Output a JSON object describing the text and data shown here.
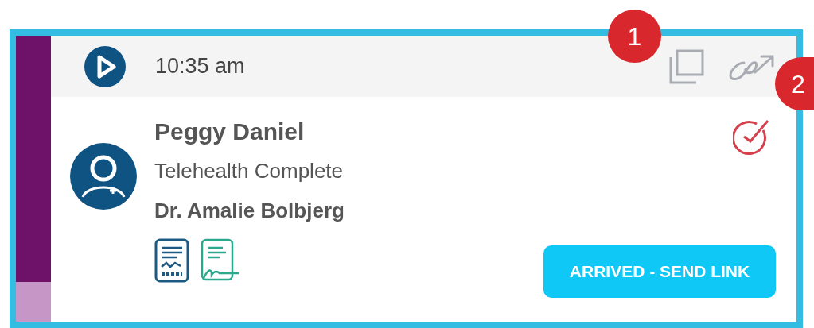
{
  "appointment": {
    "time": "10:35 am",
    "patient": "Peggy Daniel",
    "status": "Telehealth Complete",
    "provider": "Dr. Amalie Bolbjerg",
    "action_button": "ARRIVED - SEND LINK"
  },
  "stripe_segments": [
    {
      "color": "#6e1269"
    },
    {
      "color": "#c596c6"
    }
  ],
  "callouts": [
    {
      "label": "1"
    },
    {
      "label": "2"
    }
  ]
}
